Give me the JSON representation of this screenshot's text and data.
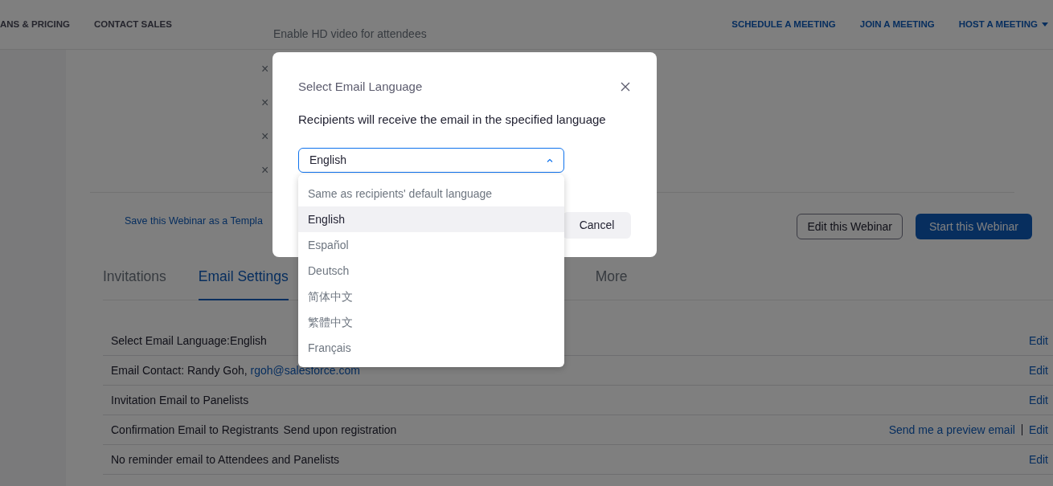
{
  "top_nav": {
    "left": [
      {
        "label": "ANS & PRICING"
      },
      {
        "label": "CONTACT SALES"
      }
    ],
    "right": [
      {
        "label": "SCHEDULE A MEETING",
        "caret": false
      },
      {
        "label": "JOIN A MEETING",
        "caret": false
      },
      {
        "label": "HOST A MEETING",
        "caret": true
      }
    ]
  },
  "video_settings": [
    {
      "label": "Enable HD video for attendees"
    }
  ],
  "removed_marks": [
    "×",
    "×",
    "×",
    "×"
  ],
  "template_link": "Save this Webinar as a Templa",
  "header_buttons": [
    {
      "label": "Edit this Webinar",
      "kind": "outline"
    },
    {
      "label": "Start this Webinar",
      "kind": "primary"
    }
  ],
  "tabs": [
    {
      "label": "Invitations",
      "selected": false
    },
    {
      "label": "Email Settings",
      "selected": true
    },
    {
      "label": "More",
      "selected": false
    }
  ],
  "email_settings": [
    {
      "label": "Select Email Language:English",
      "actions": [
        "Edit"
      ]
    },
    {
      "label": "Email Contact: Randy Goh, ",
      "link": "rgoh@salesforce.com",
      "actions": [
        "Edit"
      ]
    },
    {
      "label": "Invitation Email to Panelists",
      "actions": [
        "Edit"
      ]
    },
    {
      "label": "Confirmation Email to Registrants",
      "detail": "Send upon registration",
      "actions": [
        "Send me a preview email",
        "Edit"
      ]
    },
    {
      "label": "No reminder email to Attendees and Panelists",
      "actions": [
        "Edit"
      ]
    }
  ],
  "modal": {
    "title": "Select Email Language",
    "description": "Recipients will receive the email in the specified language",
    "select": {
      "value": "English",
      "expanded": true
    },
    "options": [
      {
        "label": "Same as recipients' default language",
        "selected": false
      },
      {
        "label": "English",
        "selected": true
      },
      {
        "label": "Español",
        "selected": false
      },
      {
        "label": "Deutsch",
        "selected": false
      },
      {
        "label": "简体中文",
        "selected": false
      },
      {
        "label": "繁體中文",
        "selected": false
      },
      {
        "label": "Français",
        "selected": false
      }
    ],
    "buttons": [
      {
        "label": "Cancel"
      }
    ]
  }
}
